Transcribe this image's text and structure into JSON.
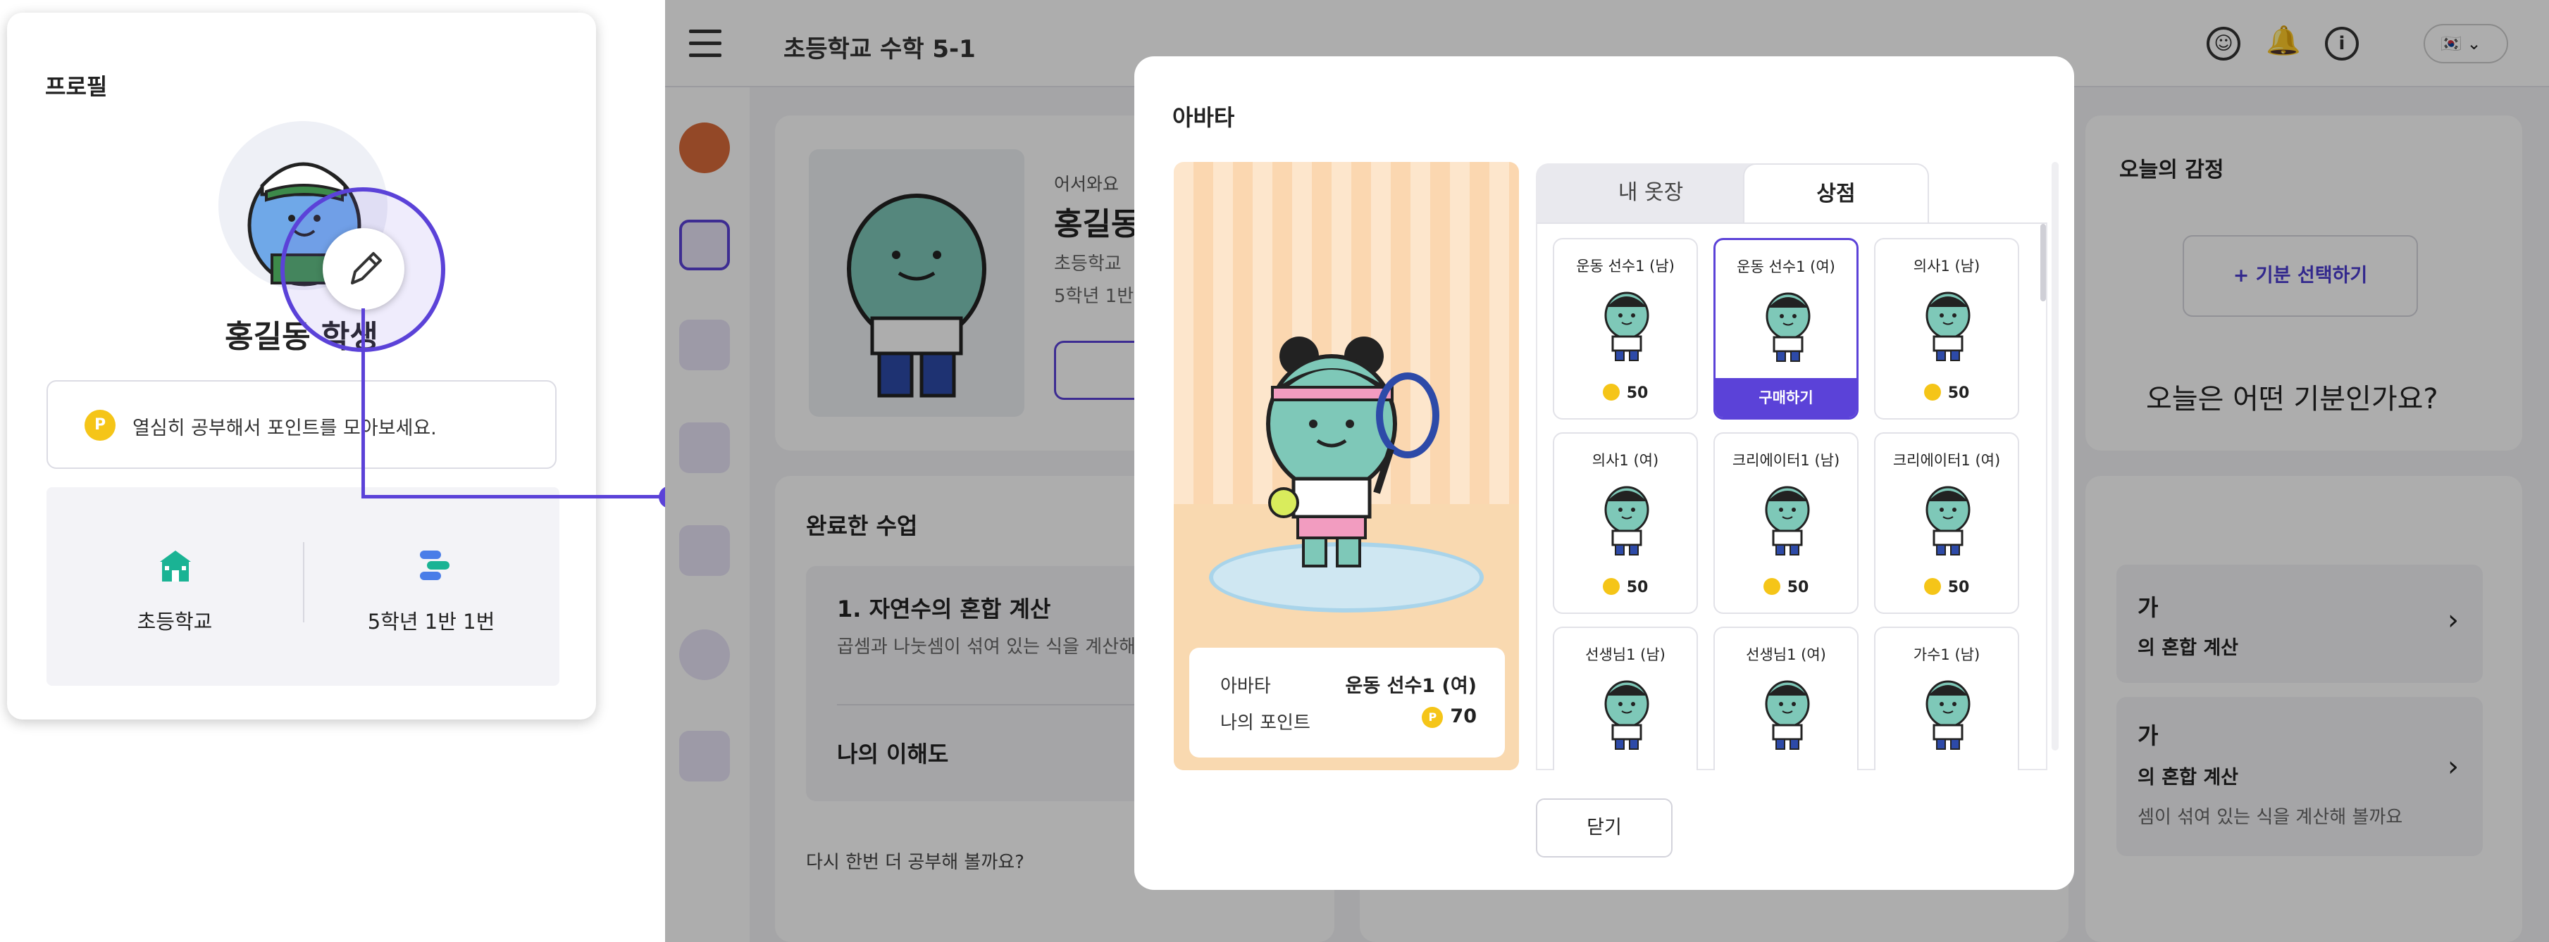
{
  "profile": {
    "title": "프로필",
    "name": "홍길동 학생",
    "point_coin": "P",
    "point_message": "열심히 공부해서 포인트를 모아보세요.",
    "school": "초등학교",
    "class": "5학년 1반 1번"
  },
  "app": {
    "title": "초등학교 수학 5-1",
    "lang": "🇰🇷 ⌄",
    "greeting": {
      "welcome": "어서와요",
      "name": "홍길동",
      "school": "초등학교",
      "class": "5학년 1반"
    },
    "emotion": {
      "title": "오늘의 감정",
      "button": "+ 기분 선택하기",
      "question": "오늘은 어떤 기분인가요?"
    },
    "completed": {
      "title": "완료한 수업",
      "lesson_title": "1. 자연수의 혼합 계산",
      "lesson_desc": "곱셈과 나눗셈이 섞여 있는 식을 계산해 볼",
      "understanding": "나의 이해도",
      "retry": "다시 한번 더 공부해 볼까요?"
    },
    "right_cards": [
      {
        "title": "가",
        "subtitle": "의 혼합 계산",
        "desc": ""
      },
      {
        "title": "가",
        "subtitle": "의 혼합 계산",
        "desc": "셈이 섞여 있는 식을 계산해 볼까요"
      }
    ]
  },
  "modal": {
    "title": "아바타",
    "preview": {
      "avatar_label": "아바타",
      "avatar_value": "운동 선수1 (여)",
      "points_label": "나의 포인트",
      "points_value": "70"
    },
    "tabs": {
      "closet": "내 옷장",
      "shop": "상점"
    },
    "items": [
      {
        "name": "운동 선수1 (남)",
        "price": "50",
        "selected": false
      },
      {
        "name": "운동 선수1 (여)",
        "price": "50",
        "selected": true,
        "buy": "구매하기"
      },
      {
        "name": "의사1 (남)",
        "price": "50",
        "selected": false
      },
      {
        "name": "의사1 (여)",
        "price": "50",
        "selected": false
      },
      {
        "name": "크리에이터1 (남)",
        "price": "50",
        "selected": false
      },
      {
        "name": "크리에이터1 (여)",
        "price": "50",
        "selected": false
      },
      {
        "name": "선생님1 (남)",
        "price": "",
        "selected": false
      },
      {
        "name": "선생님1 (여)",
        "price": "",
        "selected": false
      },
      {
        "name": "가수1 (남)",
        "price": "",
        "selected": false
      }
    ],
    "close": "닫기"
  },
  "colors": {
    "accent": "#5b42d8",
    "coin": "#f5c518",
    "avatar_body": "#7ec8b8"
  }
}
